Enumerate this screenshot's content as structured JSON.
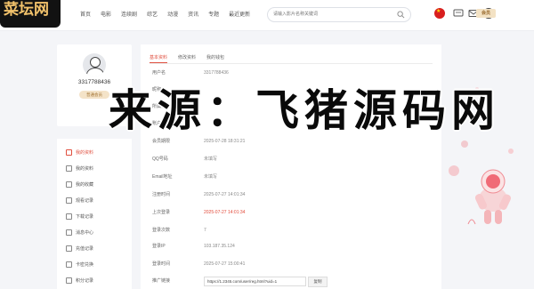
{
  "logo": {
    "text": "菜坛网"
  },
  "nav": {
    "items": [
      "首页",
      "电影",
      "连续剧",
      "综艺",
      "动漫",
      "资讯",
      "专题",
      "最近更新"
    ]
  },
  "search": {
    "placeholder": "请输入影片名称关键词"
  },
  "header": {
    "vip_label": "会员"
  },
  "profile": {
    "phone": "3317788436",
    "level_label": "普通会员"
  },
  "sidebar": {
    "items": [
      {
        "label": "我的资料",
        "active": true
      },
      {
        "label": "我的资料",
        "active": false
      },
      {
        "label": "我的收藏",
        "active": false
      },
      {
        "label": "观看记录",
        "active": false
      },
      {
        "label": "下载记录",
        "active": false
      },
      {
        "label": "消息中心",
        "active": false
      },
      {
        "label": "充值记录",
        "active": false
      },
      {
        "label": "卡密兑换",
        "active": false
      },
      {
        "label": "积分记录",
        "active": false
      }
    ]
  },
  "tabs": [
    "基本资料",
    "修改资料",
    "我的钱包"
  ],
  "info": {
    "rows": [
      {
        "key": "用户名",
        "value": "3317788436",
        "red": false
      },
      {
        "key": "昵称",
        "value": "",
        "red": false
      },
      {
        "key": "所属会员组",
        "value": "",
        "red": false
      },
      {
        "key": "账户积分",
        "value": "",
        "red": false
      },
      {
        "key": "会员期限",
        "value": "2025-07-28 18:31:21",
        "red": false
      },
      {
        "key": "QQ号码",
        "value": "未填写",
        "red": false
      },
      {
        "key": "Email地址",
        "value": "未填写",
        "red": false
      },
      {
        "key": "注册时间",
        "value": "2025-07-27 14:01:34",
        "red": false
      },
      {
        "key": "上次登录",
        "value": "2025-07-27 14:01:34",
        "red": true
      },
      {
        "key": "登录次数",
        "value": "7",
        "red": false
      },
      {
        "key": "登录IP",
        "value": "103.187.35.124",
        "red": false
      },
      {
        "key": "登录时间",
        "value": "2025-07-27 15:00:41",
        "red": false
      }
    ],
    "invite": {
      "key": "推广链接",
      "url": "https://1.2345.com/user/reg.html?uid=1",
      "button": "复制"
    }
  },
  "watermark": {
    "text": "来源：飞猪源码网"
  },
  "colors": {
    "accent": "#e05040",
    "gold": "#f4e3c8",
    "bg": "#f4f5f8"
  }
}
